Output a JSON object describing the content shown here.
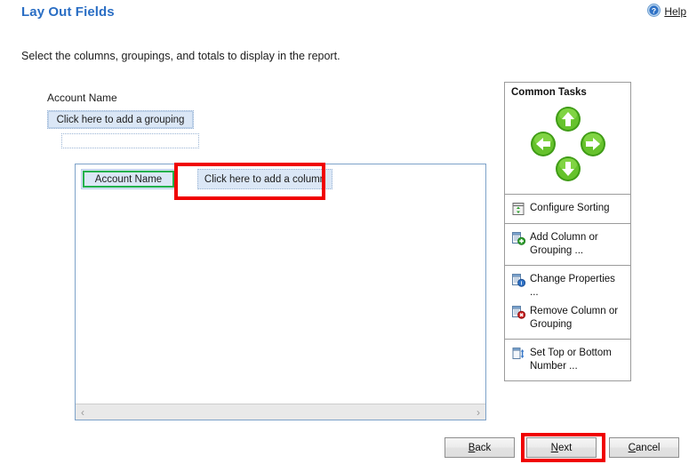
{
  "header": {
    "title": "Lay Out Fields",
    "help_label": "Help",
    "help_icon": "help-circle-icon"
  },
  "instruction": "Select the columns, groupings, and totals to display in the report.",
  "grouping": {
    "field_label": "Account Name",
    "add_grouping_label": "Click here to add a grouping",
    "empty_slot_label": ""
  },
  "designer": {
    "columns": [
      {
        "label": "Account Name",
        "state": "selected"
      },
      {
        "label": "Click here to add a column",
        "state": "placeholder"
      }
    ],
    "scrollbar": {
      "left_arrow": "‹",
      "right_arrow": "›"
    }
  },
  "common_tasks": {
    "title": "Common Tasks",
    "nav_buttons": [
      {
        "name": "move-up",
        "icon": "arrow-up-icon"
      },
      {
        "name": "move-left",
        "icon": "arrow-left-icon"
      },
      {
        "name": "move-right",
        "icon": "arrow-right-icon"
      },
      {
        "name": "move-down",
        "icon": "arrow-down-icon"
      }
    ],
    "groups": [
      {
        "items": [
          {
            "label": "Configure Sorting",
            "icon": "configure-sorting-icon"
          }
        ]
      },
      {
        "items": [
          {
            "label": "Add Column or\nGrouping ...",
            "icon": "add-column-icon"
          }
        ]
      },
      {
        "items": [
          {
            "label": "Change Properties ...",
            "icon": "change-properties-icon"
          },
          {
            "label": "Remove Column or\nGrouping",
            "icon": "remove-column-icon"
          }
        ]
      },
      {
        "items": [
          {
            "label": "Set Top or Bottom\nNumber ...",
            "icon": "set-top-bottom-icon"
          }
        ]
      }
    ]
  },
  "footer": {
    "buttons": [
      {
        "name": "back",
        "label": "Back",
        "accel": "B",
        "highlighted": false
      },
      {
        "name": "next",
        "label": "Next",
        "accel": "N",
        "highlighted": true
      },
      {
        "name": "cancel",
        "label": "Cancel",
        "accel": "C",
        "highlighted": false
      }
    ]
  },
  "colors": {
    "title_blue": "#2a6ec4",
    "selection_green": "#22b14c",
    "callout_red": "#f00000",
    "field_fill": "#dbe7f6",
    "panel_border": "#7da2c9"
  }
}
